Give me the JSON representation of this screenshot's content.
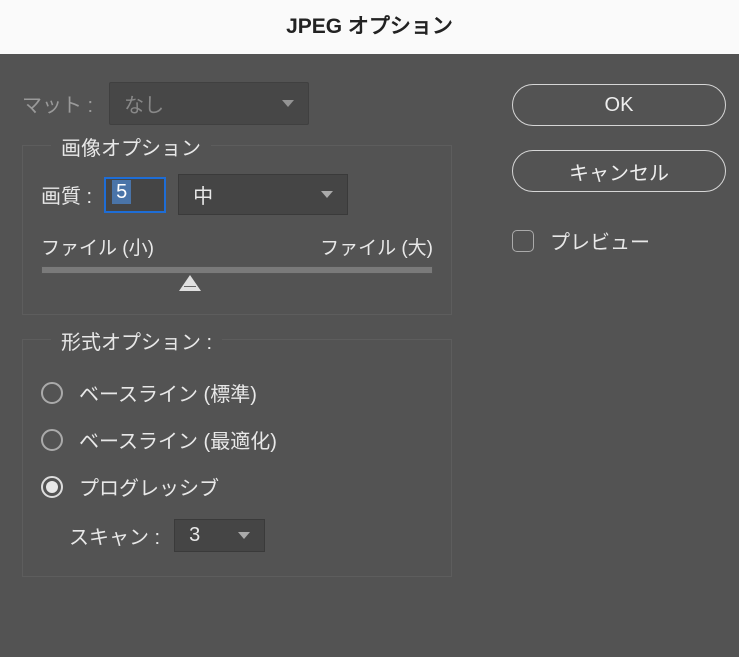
{
  "title": "JPEG オプション",
  "matte": {
    "label": "マット :",
    "value": "なし"
  },
  "image_options": {
    "legend": "画像オプション",
    "quality_label": "画質 :",
    "quality_value": "5",
    "quality_level": "中",
    "file_small": "ファイル (小)",
    "file_large": "ファイル (大)"
  },
  "format_options": {
    "legend": "形式オプション :",
    "baseline_standard": "ベースライン (標準)",
    "baseline_optimized": "ベースライン (最適化)",
    "progressive": "プログレッシブ",
    "selected": "progressive",
    "scans_label": "スキャン :",
    "scans_value": "3"
  },
  "buttons": {
    "ok": "OK",
    "cancel": "キャンセル"
  },
  "preview": {
    "label": "プレビュー",
    "checked": false
  }
}
